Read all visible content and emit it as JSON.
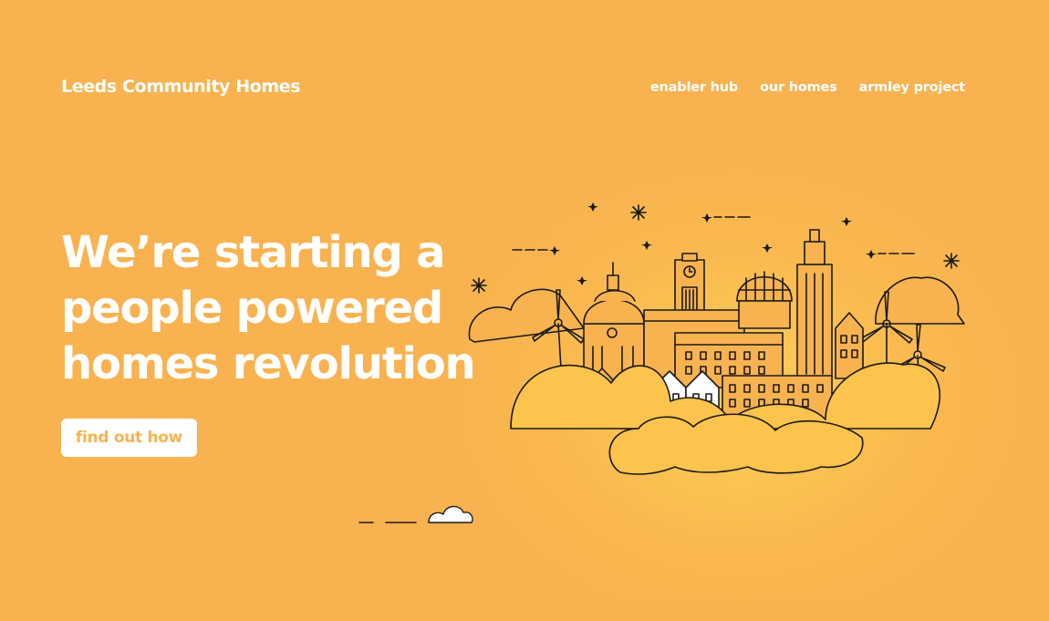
{
  "site": {
    "logo_text": "Leeds Community Homes"
  },
  "nav": {
    "items": [
      {
        "label": "enabler hub"
      },
      {
        "label": "our homes"
      },
      {
        "label": "armley project"
      }
    ]
  },
  "hero": {
    "lines": [
      "We’re starting a",
      "people powered",
      "homes revolution"
    ],
    "cta_label": "find out how"
  },
  "colors": {
    "background": "#f8b24f",
    "accent": "#ffffff",
    "line": "#1a1a1a"
  },
  "icons": [
    "sparkle-icon",
    "star-icon",
    "cloud-icon",
    "wind-turbine-icon",
    "city-skyline-illustration"
  ]
}
